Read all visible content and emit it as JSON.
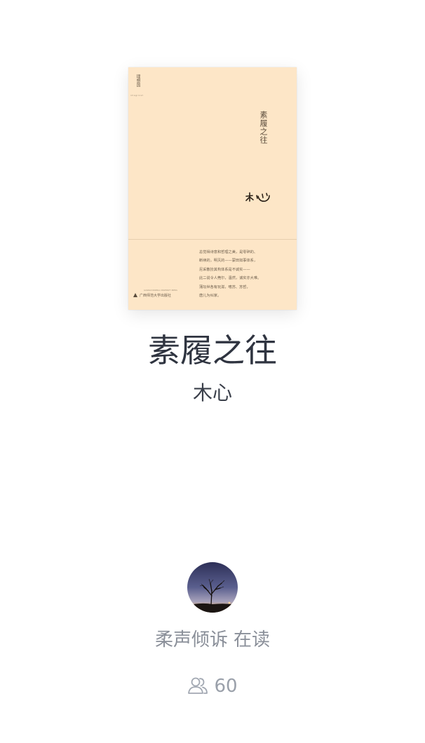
{
  "book": {
    "title": "素履之往",
    "author": "木心",
    "cover": {
      "publisher_mark": "理想国",
      "publisher_mark_sub": "imaginist",
      "vertical_title": "素履之往",
      "signature": "木心",
      "blurb": "总觉得诗意和哲理之美，是零碎的、\n断续的，明灭的——蒙田如事体系，\n尼采散扮其构体系是不诚实——\n此二说令人莞尔，温然，诚实亦大难。\n蒲坛世各有玩滋，嗜苏、苏哲，\n唐儿为纠家。",
      "press_name": "广西师范大学出版社",
      "press_tiny": "GUANGXI NORMAL UNIVERSITY PRESS",
      "background_color": "#fde6c7"
    }
  },
  "reader": {
    "avatar_icon": "avatar-twilight-tree",
    "name": "柔声倾诉",
    "status": "在读"
  },
  "stats": {
    "people_icon": "people-icon",
    "count": "60"
  }
}
